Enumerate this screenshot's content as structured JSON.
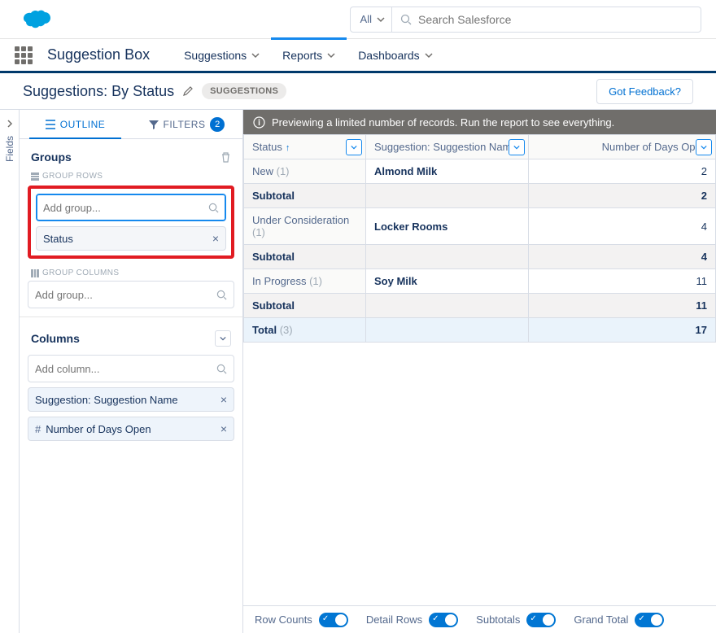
{
  "header": {
    "searchScope": "All",
    "searchPlaceholder": "Search Salesforce"
  },
  "nav": {
    "appName": "Suggestion Box",
    "items": [
      "Suggestions",
      "Reports",
      "Dashboards"
    ],
    "activeIndex": 1
  },
  "page": {
    "title": "Suggestions: By Status",
    "chip": "SUGGESTIONS",
    "feedback": "Got Feedback?"
  },
  "sidebarTabs": {
    "outline": "OUTLINE",
    "filters": "FILTERS",
    "filterCount": 2
  },
  "fieldsRail": "Fields",
  "groups": {
    "heading": "Groups",
    "rowsLabel": "GROUP ROWS",
    "colsLabel": "GROUP COLUMNS",
    "addPlaceholder": "Add group...",
    "selected": "Status"
  },
  "columns": {
    "heading": "Columns",
    "addPlaceholder": "Add column...",
    "items": [
      "Suggestion: Suggestion Name",
      "Number of Days Open"
    ]
  },
  "previewMsg": "Previewing a limited number of records. Run the report to see everything.",
  "table": {
    "headers": [
      "Status",
      "Suggestion: Suggestion Name",
      "Number of Days Open"
    ],
    "rows": [
      {
        "type": "group",
        "status": "New",
        "count": 1,
        "name": "Almond Milk",
        "days": 2
      },
      {
        "type": "subtotal",
        "label": "Subtotal",
        "days": 2
      },
      {
        "type": "group",
        "status": "Under Consideration",
        "count": 1,
        "name": "Locker Rooms",
        "days": 4
      },
      {
        "type": "subtotal",
        "label": "Subtotal",
        "days": 4
      },
      {
        "type": "group",
        "status": "In Progress",
        "count": 1,
        "name": "Soy Milk",
        "days": 11
      },
      {
        "type": "subtotal",
        "label": "Subtotal",
        "days": 11
      },
      {
        "type": "total",
        "label": "Total",
        "count": 3,
        "days": 17
      }
    ]
  },
  "footer": {
    "rowCounts": "Row Counts",
    "detailRows": "Detail Rows",
    "subtotals": "Subtotals",
    "grandTotal": "Grand Total"
  }
}
